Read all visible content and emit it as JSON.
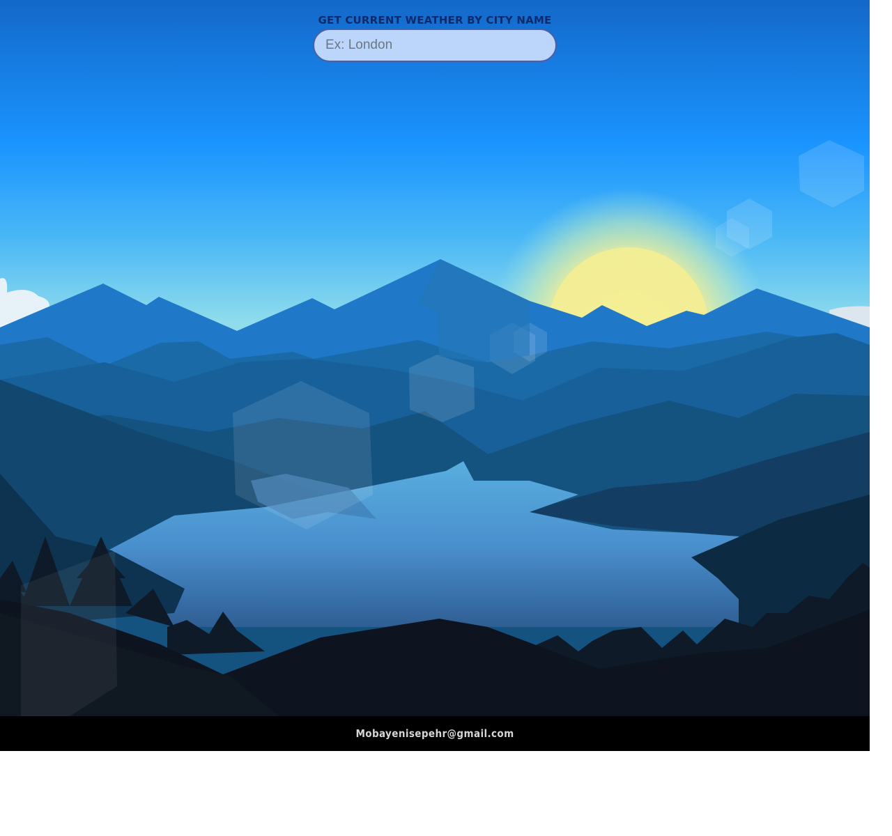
{
  "search": {
    "label": "GET CURRENT WEATHER BY CITY NAME",
    "placeholder": "Ex: London",
    "value": ""
  },
  "footer": {
    "email": "Mobayenisepehr@gmail.com"
  },
  "colors": {
    "sky_top": "#1565c0",
    "sky_mid": "#1a94ff",
    "sky_horizon": "#9fe3ea",
    "sun": "#f5ef98",
    "footer_bg": "#000000",
    "input_bg": "#bcd5fb",
    "label_color": "#0e2a6b"
  },
  "background": {
    "icon": "mountain-lake-landscape"
  }
}
